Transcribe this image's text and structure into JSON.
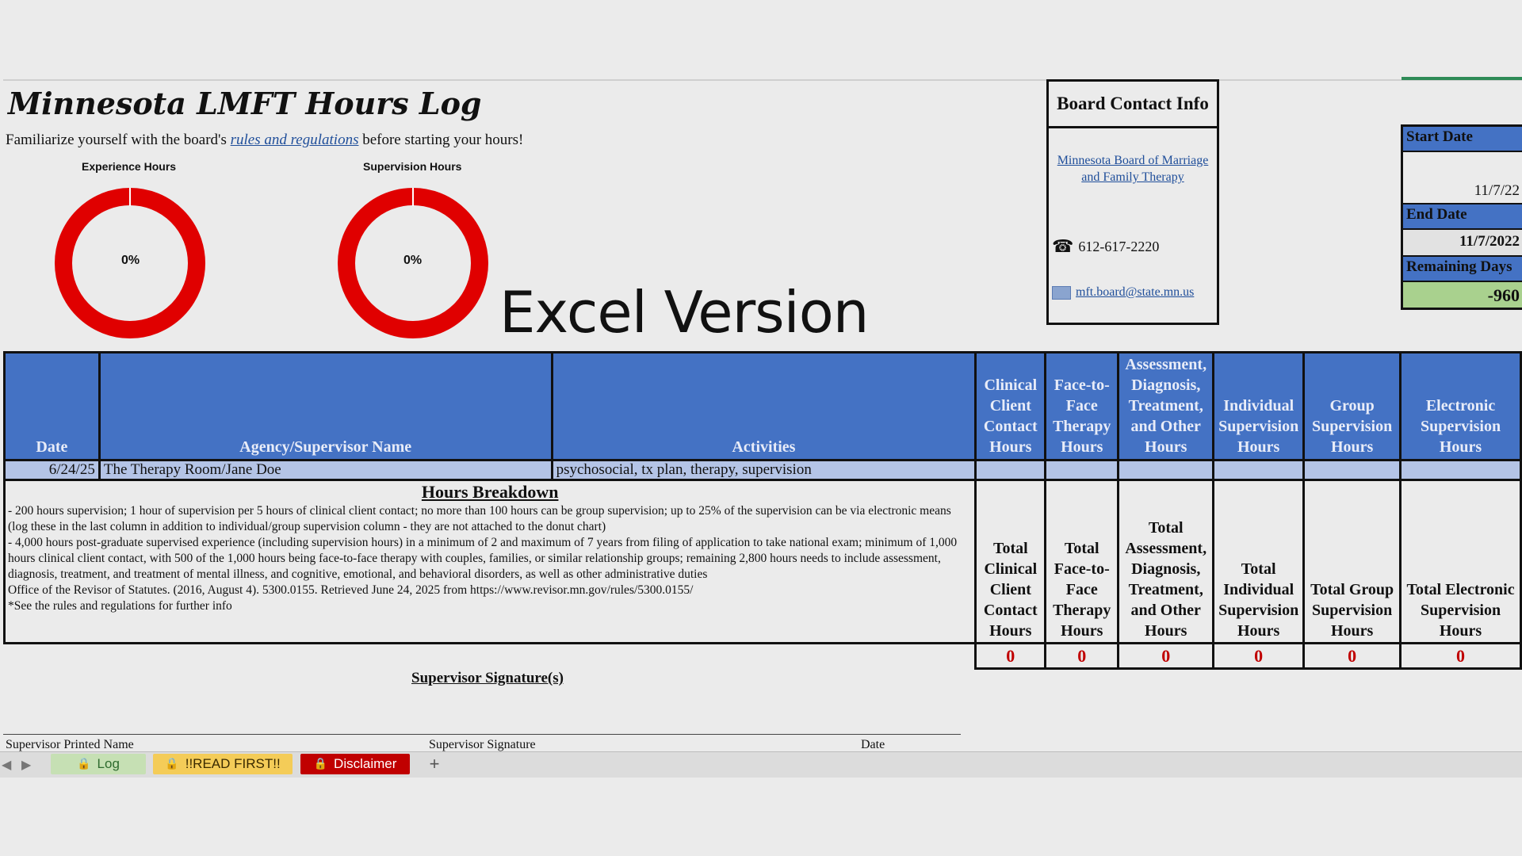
{
  "title": "Minnesota LMFT Hours Log",
  "subtitle": {
    "before": "Familiarize yourself with the board's ",
    "link": "rules and regulations",
    "after": " before starting your hours!"
  },
  "charts": {
    "experience": {
      "title": "Experience Hours",
      "label": "0%",
      "percent": 0,
      "ring_color": "#e00000"
    },
    "supervision": {
      "title": "Supervision Hours",
      "label": "0%",
      "percent": 0,
      "ring_color": "#e00000"
    }
  },
  "overlay_text": "Excel Version",
  "board": {
    "header": "Board Contact Info",
    "link": "Minnesota Board of Marriage and Family Therapy",
    "phone": "612-617-2220",
    "email": "mft.board@state.mn.us"
  },
  "dates": {
    "start_label": "Start Date",
    "start_value": "11/7/22",
    "end_label": "End Date",
    "end_value": "11/7/2022",
    "remaining_label": "Remaining Days",
    "remaining_value": "-960"
  },
  "table": {
    "headers": {
      "date": "Date",
      "agency": "Agency/Supervisor Name",
      "activities": "Activities",
      "clinical": "Clinical Client Contact Hours",
      "face": "Face-to-Face Therapy Hours",
      "assessment": "Assessment, Diagnosis, Treatment, and Other Hours",
      "individual": "Individual Supervision Hours",
      "group": "Group Supervision Hours",
      "electronic": "Electronic Supervision Hours"
    },
    "row": {
      "date": "6/24/25",
      "agency": "The Therapy Room/Jane Doe",
      "activities": "psychosocial, tx plan, therapy, supervision"
    },
    "totals": {
      "clinical": "Total Clinical Client Contact Hours",
      "face": "Total Face-to-Face Therapy Hours",
      "assessment": "Total Assessment, Diagnosis, Treatment, and Other Hours",
      "individual": "Total Individual Supervision Hours",
      "group": "Total Group Supervision Hours",
      "electronic": "Total Electronic Supervision Hours"
    },
    "total_values": {
      "clinical": "0",
      "face": "0",
      "assessment": "0",
      "individual": "0",
      "group": "0",
      "electronic": "0"
    }
  },
  "breakdown": {
    "title": "Hours Breakdown",
    "line1": "- 200 hours supervision; 1 hour of supervision per 5 hours of clinical client contact; no more than 100 hours can be group supervision; up to 25% of the supervision can be via electronic means (log these in the last column in addition to individual/group supervision column - they are not attached to the donut chart)",
    "line2": "- 4,000 hours post-graduate supervised experience (including supervision hours) in a minimum of 2 and maximum of 7 years from filing of application to take national exam; minimum of 1,000 hours clinical client contact, with 500 of the 1,000 hours being face-to-face therapy with couples, families, or similar relationship groups; remaining 2,800 hours needs to include assessment, diagnosis, treatment, and treatment of mental illness, and cognitive, emotional, and behavioral disorders, as well as other administrative duties",
    "citation": "Office of the Revisor of Statutes. (2016, August 4). 5300.0155. Retrieved June 24, 2025 from https://www.revisor.mn.gov/rules/5300.0155/",
    "note": "*See the rules and regulations for further info"
  },
  "signature": {
    "title": "Supervisor Signature(s)",
    "printed_name": "Supervisor Printed Name",
    "signature": "Supervisor Signature",
    "date": "Date"
  },
  "tabs": {
    "log": "Log",
    "read_first": "!!READ FIRST!!",
    "disclaimer": "Disclaimer",
    "add": "+",
    "log_color": "#c6e0b4",
    "read_first_color": "#f4cc58",
    "disclaimer_color": "#c00000"
  }
}
